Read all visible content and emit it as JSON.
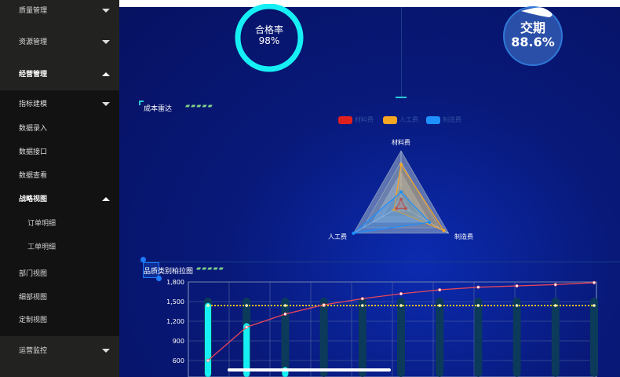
{
  "sidebar": {
    "items": [
      {
        "label": "质量管理",
        "arrow": "down"
      },
      {
        "label": "资源管理",
        "arrow": "down"
      },
      {
        "label": "经营管理",
        "arrow": "up"
      },
      {
        "label": "指标建模",
        "arrow": "down"
      },
      {
        "label": "数据录入"
      },
      {
        "label": "数据接口"
      },
      {
        "label": "数据查看"
      },
      {
        "label": "战略视图",
        "arrow": "up"
      },
      {
        "label": "订单明细"
      },
      {
        "label": "工单明细"
      },
      {
        "label": "部门视图"
      },
      {
        "label": "细部视图"
      },
      {
        "label": "定制视图"
      },
      {
        "label": "运营监控",
        "arrow": "down"
      }
    ]
  },
  "gauges": {
    "pass_rate": {
      "label": "合格率",
      "value": "98%",
      "percent": 98,
      "color": "#16f0f5"
    },
    "delivery": {
      "label": "交期",
      "value": "88.6%",
      "percent": 88.6
    }
  },
  "chart_data": [
    {
      "type": "radar",
      "title": "成本雷达",
      "indicators": [
        "材料费",
        "人工费",
        "制造费"
      ],
      "legend": [
        "材料费",
        "人工费",
        "制造费"
      ],
      "legend_position": "top-right",
      "series": [
        {
          "name": "材料费",
          "color": "#e0201c",
          "values": [
            0.12,
            0.1,
            0.1
          ]
        },
        {
          "name": "人工费",
          "color": "#f5a623",
          "values": [
            0.75,
            0.15,
            0.9
          ]
        },
        {
          "name": "制造费",
          "color": "#1e90ff",
          "values": [
            0.25,
            1.0,
            0.6
          ]
        }
      ]
    },
    {
      "type": "bar",
      "title": "品质类别柏拉图",
      "y_ticks": [
        "1,800",
        "1,500",
        "1,200",
        "900",
        "600"
      ],
      "ylim": [
        0,
        1800
      ],
      "grid": true,
      "bar_values": [
        1480,
        1170,
        500,
        300,
        250,
        200,
        170,
        140,
        110,
        90,
        70
      ],
      "cumulative_line": [
        600,
        1110,
        1310,
        1450,
        1545,
        1620,
        1680,
        1720,
        1740,
        1760,
        1790
      ],
      "reference_line": 1440,
      "colors": {
        "bar": "#16f0f5",
        "line": "#e8475a",
        "reference": "#f5c518"
      }
    }
  ]
}
